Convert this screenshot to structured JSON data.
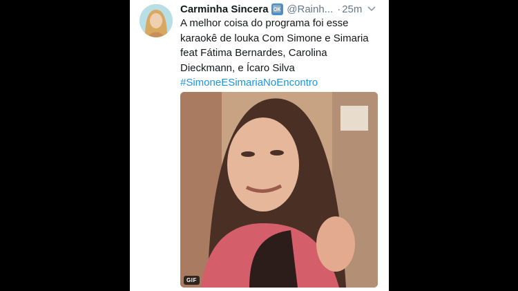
{
  "tweet": {
    "author_name": "Carminha Sincera",
    "verified_emoji": "🆗",
    "handle": "@Rainh...",
    "separator": "·",
    "time_ago": "25m",
    "text": "A melhor coisa do programa foi esse karaokê de louka Com Simone e Simaria feat Fátima Bernardes, Carolina Dieckmann, e Ícaro Silva",
    "hashtag": "#SimoneESimariaNoEncontro"
  },
  "media": {
    "badge": "GIF"
  },
  "colors": {
    "background": "#000000",
    "card": "#ffffff",
    "hashtag": "#1b95e0",
    "secondary_text": "#657786"
  }
}
